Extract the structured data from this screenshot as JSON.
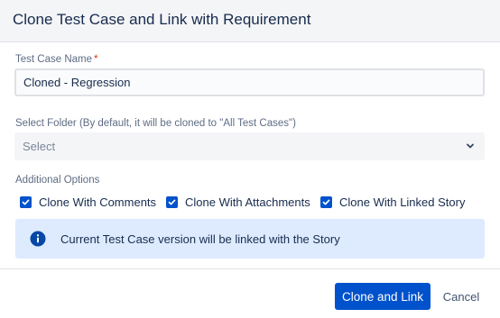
{
  "dialog": {
    "title": "Clone Test Case and Link with Requirement"
  },
  "fields": {
    "name_label": "Test Case Name",
    "required_marker": "*",
    "name_value": "Cloned - Regression",
    "folder_label": "Select Folder (By default, it will be cloned to \"All Test Cases\")",
    "folder_placeholder": "Select",
    "folder_icon": "chevron-down-icon"
  },
  "options": {
    "heading": "Additional Options",
    "items": [
      {
        "label": "Clone With Comments",
        "checked": true
      },
      {
        "label": "Clone With Attachments",
        "checked": true
      },
      {
        "label": "Clone With Linked Story",
        "checked": true
      }
    ]
  },
  "info": {
    "icon": "info-icon",
    "text": "Current Test Case version will be linked with the Story"
  },
  "footer": {
    "primary_label": "Clone and Link",
    "cancel_label": "Cancel"
  },
  "colors": {
    "primary": "#0052cc",
    "info_bg": "#deebff",
    "header_bg": "#f4f5f7",
    "required": "#de350b"
  }
}
